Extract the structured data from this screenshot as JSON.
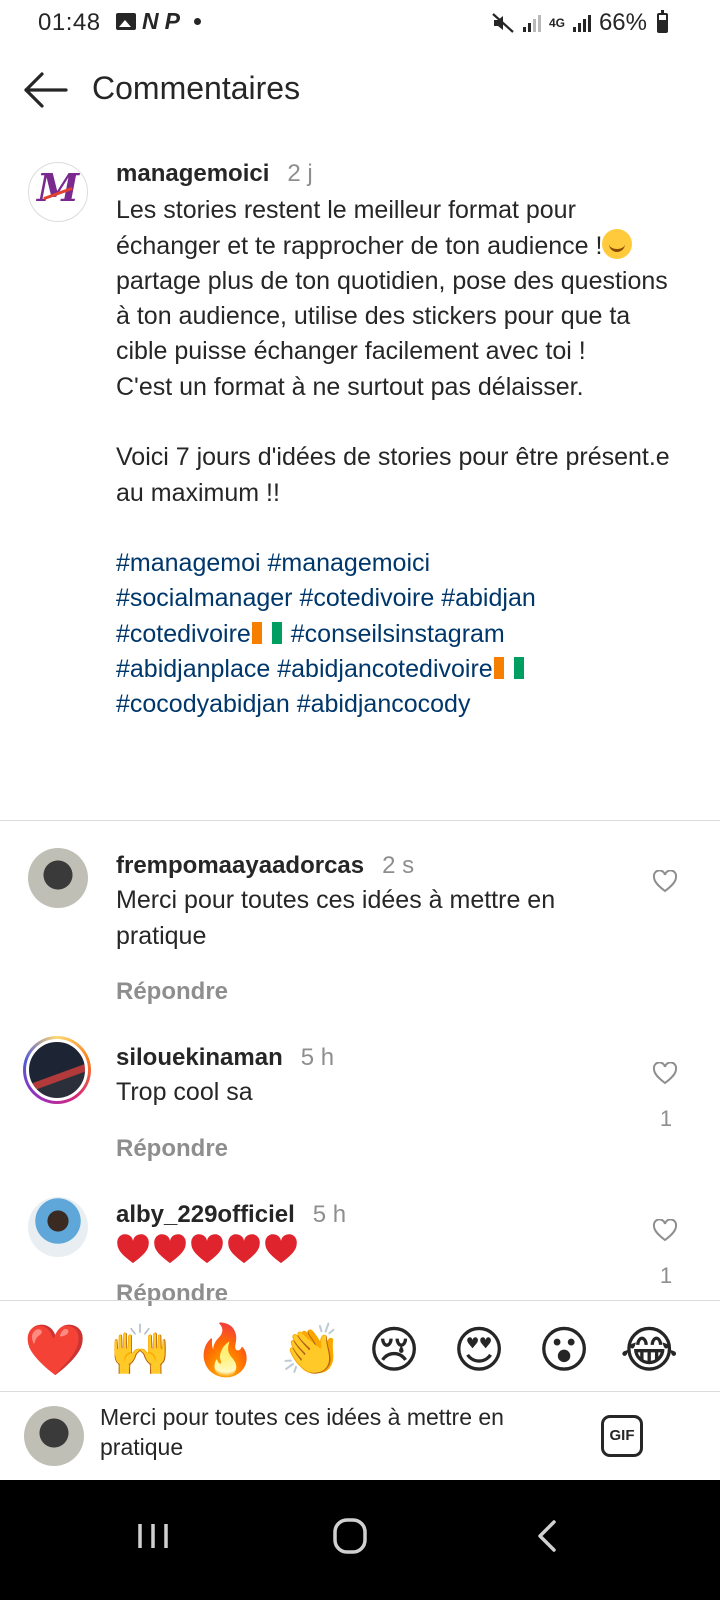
{
  "status_bar": {
    "time": "01:48",
    "icons_left": [
      "gallery-icon",
      "n-icon",
      "p-icon",
      "dot-icon"
    ],
    "letter_n": "N",
    "letter_p": "P",
    "battery_text": "66%",
    "network": "4G",
    "battery_level": 0.66
  },
  "header": {
    "title": "Commentaires",
    "back_icon": "arrow-left-icon"
  },
  "caption": {
    "username": "managemoici",
    "time": "2 j",
    "line1": "Les stories restent le meilleur format pour échanger et te rapprocher de ton audience !",
    "line2": "partage plus de ton quotidien, pose des questions à ton audience, utilise des stickers pour que ta cible puisse échanger facilement avec toi !\nC'est un format à ne surtout pas délaisser.\n\nVoici 7 jours d'idées de stories pour être présent.e au maximum !!",
    "hashtags": [
      "#managemoi",
      "#managemoici",
      "#socialmanager",
      "#cotedivoire",
      "#abidjan",
      "#cotedivoire",
      "#conseilsinstagram",
      "#abidjanplace",
      "#abidjancotedivoire",
      "#cocodyabidjan",
      "#abidjancocody"
    ]
  },
  "comments": [
    {
      "username": "frempomaayaadorcas",
      "time": "2 s",
      "text": "Merci pour toutes ces idées à mettre en pratique",
      "reply": "Répondre",
      "likes": ""
    },
    {
      "username": "silouekinaman",
      "time": "5 h",
      "text": "Trop cool sa",
      "reply": "Répondre",
      "likes": "1"
    },
    {
      "username": "alby_229officiel",
      "time": "5 h",
      "text": "",
      "reply": "Répondre",
      "likes": "1",
      "hearts": 5
    }
  ],
  "emoji_bar": [
    "❤️",
    "🙌",
    "🔥",
    "👏",
    "😢",
    "😍",
    "😮",
    "😂"
  ],
  "composer": {
    "value": "Merci pour toutes ces idées à mettre en pratique",
    "gif_label": "GIF"
  },
  "colors": {
    "hashtag": "#00376b",
    "muted": "#8e8e8e",
    "text": "#262626",
    "divider": "#dbdbdb"
  }
}
